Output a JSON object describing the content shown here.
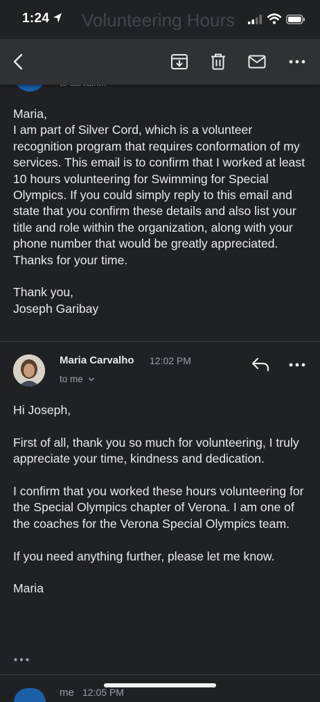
{
  "status_bar": {
    "time": "1:24",
    "ghost_title": "Volunteering Hours"
  },
  "toolbar": {
    "icons": [
      "back-arrow-icon",
      "archive-icon",
      "delete-icon",
      "mark-unread-icon",
      "more-options-icon"
    ]
  },
  "previous_message": {
    "recipient": "to carvalhm"
  },
  "first_email": {
    "greeting": "Maria,",
    "body": "I am part of Silver Cord, which is a volunteer recognition program that requires conformation of my services. This email is to confirm that I worked at least 10 hours volunteering for Swimming for Special Olympics. If you could simply reply to this email and state that you confirm these details and also list your title and role within the organization, along with your phone number that would be greatly appreciated. Thanks for your time.",
    "closing": "Thank you,",
    "signature": "Joseph Garibay"
  },
  "reply": {
    "sender": "Maria Carvalho",
    "time": "12:02 PM",
    "recipient": "to me",
    "greeting": "Hi Joseph,",
    "para1": "First of all, thank you so much for volunteering, I truly appreciate your time, kindness and dedication.",
    "para2": "I confirm that you worked these hours volunteering for the Special Olympics chapter of Verona. I am one of the coaches for the Verona Special Olympics team.",
    "para3": "If you need anything further, please let me know.",
    "signature": "Maria"
  },
  "next_message": {
    "sender": "me",
    "time": "12:05 PM"
  },
  "colors": {
    "background": "#202124",
    "toolbar": "#303134",
    "text": "#e8eaed",
    "secondary_text": "#9aa0a6",
    "avatar_blue": "#1a5fa8"
  }
}
